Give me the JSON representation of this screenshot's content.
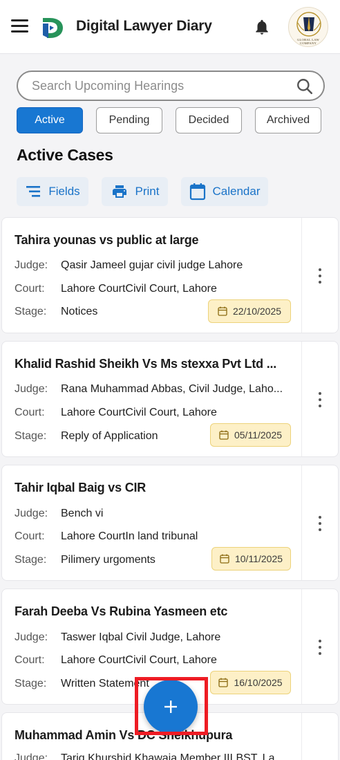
{
  "app": {
    "title": "Digital Lawyer Diary",
    "avatar_caption": "GLOBAL LAW COMPANY"
  },
  "search": {
    "placeholder": "Search Upcoming Hearings"
  },
  "tabs": [
    {
      "label": "Active",
      "selected": true
    },
    {
      "label": "Pending",
      "selected": false
    },
    {
      "label": "Decided",
      "selected": false
    },
    {
      "label": "Archived",
      "selected": false
    }
  ],
  "section_title": "Active Cases",
  "actions": {
    "fields": "Fields",
    "print": "Print",
    "calendar": "Calendar"
  },
  "labels": {
    "judge": "Judge:",
    "court": "Court:",
    "stage": "Stage:"
  },
  "cases": [
    {
      "title": "Tahira younas vs public at large",
      "judge": "Qasir Jameel gujar civil judge Lahore",
      "court": "Lahore CourtCivil Court, Lahore",
      "stage": "Notices",
      "date": "22/10/2025"
    },
    {
      "title": "Khalid Rashid Sheikh Vs Ms stexxa Pvt Ltd ...",
      "judge": "Rana Muhammad Abbas, Civil Judge, Laho...",
      "court": "Lahore CourtCivil Court, Lahore",
      "stage": "Reply of Application",
      "date": "05/11/2025"
    },
    {
      "title": "Tahir Iqbal Baig vs CIR",
      "judge": "Bench vi",
      "court": "Lahore CourtIn land tribunal",
      "stage": "Pilimery urgoments",
      "date": "10/11/2025"
    },
    {
      "title": "Farah Deeba Vs Rubina Yasmeen etc",
      "judge": "Taswer Iqbal Civil Judge, Lahore",
      "court": "Lahore CourtCivil Court, Lahore",
      "stage": "Written Statement",
      "date": "16/10/2025"
    },
    {
      "title": "Muhammad Amin Vs DC Sheikhupura",
      "judge": "Tariq Khurshid Khawaja Member III BST, La..."
    }
  ],
  "colors": {
    "primary": "#1877d2",
    "chip_bg": "#fdf0c7",
    "highlight": "#ee1c24"
  },
  "icons": {
    "menu": "menu-icon",
    "logo": "app-logo",
    "bell": "bell-icon",
    "search": "search-icon",
    "fields": "filter-list-icon",
    "print": "printer-icon",
    "calendar": "calendar-icon",
    "date": "calendar-small-icon",
    "more": "more-vert-icon",
    "fab": "plus-icon"
  }
}
